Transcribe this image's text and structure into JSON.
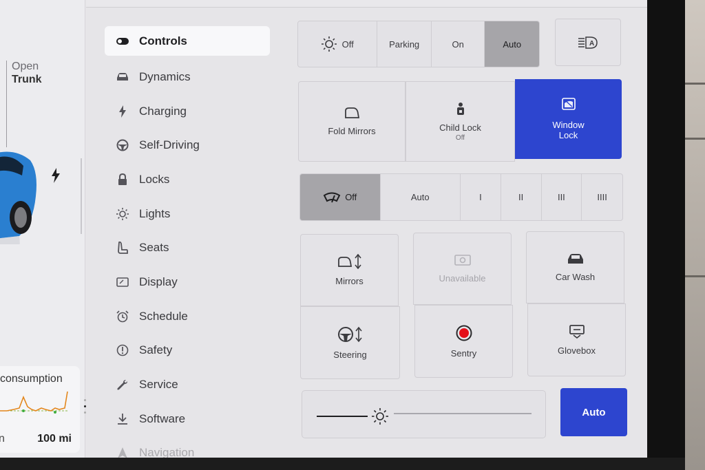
{
  "car": {
    "trunk_state": "Open",
    "trunk_label": "Trunk"
  },
  "consumption": {
    "title": "consumption",
    "left_label": "n",
    "range_label": "100 mi"
  },
  "menu": {
    "items": [
      {
        "label": "Controls",
        "icon": "toggle-icon"
      },
      {
        "label": "Dynamics",
        "icon": "car-icon"
      },
      {
        "label": "Charging",
        "icon": "bolt-icon"
      },
      {
        "label": "Self-Driving",
        "icon": "steering-wheel-icon"
      },
      {
        "label": "Locks",
        "icon": "lock-icon"
      },
      {
        "label": "Lights",
        "icon": "sun-icon"
      },
      {
        "label": "Seats",
        "icon": "seat-icon"
      },
      {
        "label": "Display",
        "icon": "display-icon"
      },
      {
        "label": "Schedule",
        "icon": "alarm-clock-icon"
      },
      {
        "label": "Safety",
        "icon": "alert-circle-icon"
      },
      {
        "label": "Service",
        "icon": "wrench-icon"
      },
      {
        "label": "Software",
        "icon": "download-icon"
      },
      {
        "label": "Navigation",
        "icon": "navigation-icon"
      }
    ]
  },
  "headlights": {
    "options": [
      "Off",
      "Parking",
      "On",
      "Auto"
    ],
    "selected": "Auto",
    "auto_high_beam_icon": "auto-high-beam-icon"
  },
  "mirrors_locks": {
    "fold_mirrors": "Fold Mirrors",
    "child_lock": "Child Lock",
    "child_lock_state": "Off",
    "window_lock_line1": "Window",
    "window_lock_line2": "Lock"
  },
  "wipers": {
    "options": [
      "Off",
      "Auto",
      "I",
      "II",
      "III",
      "IIII"
    ],
    "selected": "Off"
  },
  "adjust": {
    "mirrors": "Mirrors",
    "steering": "Steering",
    "unavailable": "Unavailable",
    "sentry": "Sentry",
    "car_wash": "Car Wash",
    "glovebox": "Glovebox"
  },
  "brightness": {
    "auto_label": "Auto",
    "level_fraction": 0.22
  },
  "colors": {
    "accent_blue": "#2d45cf",
    "sentry_red": "#e4101a",
    "selected_gray": "#a6a5a9"
  }
}
